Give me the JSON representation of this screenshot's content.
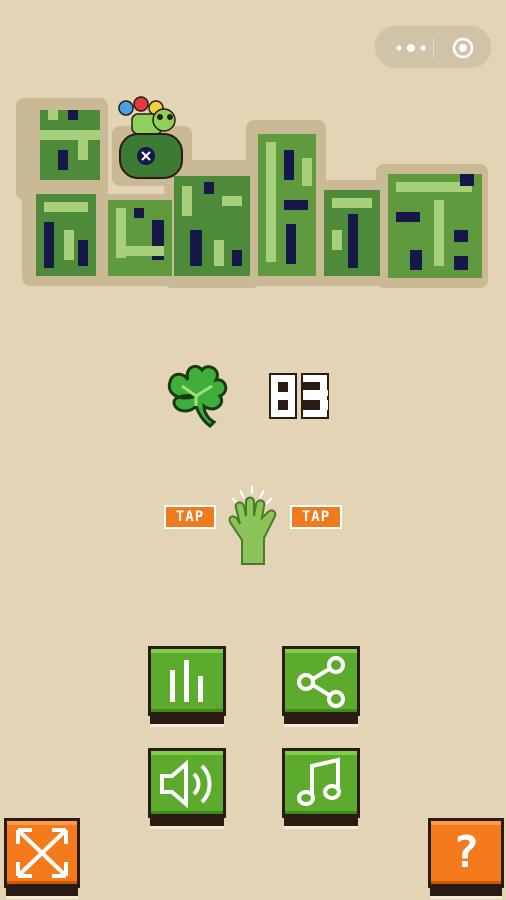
{
  "capsule": {
    "icons": [
      "more-dots-icon",
      "close-target-icon"
    ]
  },
  "title": {
    "text": "青蛙射手",
    "style": "pixel-art-logo"
  },
  "score": {
    "icon": "clover-icon",
    "value": "85"
  },
  "hint": {
    "left_label": "TAP",
    "right_label": "TAP",
    "icon": "tap-hand-icon"
  },
  "buttons": [
    {
      "icon": "leaderboard-icon"
    },
    {
      "icon": "share-icon"
    },
    {
      "icon": "sound-icon"
    },
    {
      "icon": "music-icon"
    }
  ],
  "corner": {
    "left_icon": "fullscreen-arrows-icon",
    "right_label": "?"
  },
  "colors": {
    "background": "#e2d4b4",
    "green": "#5cab2c",
    "orange": "#f47a1c",
    "navy": "#16184a"
  }
}
